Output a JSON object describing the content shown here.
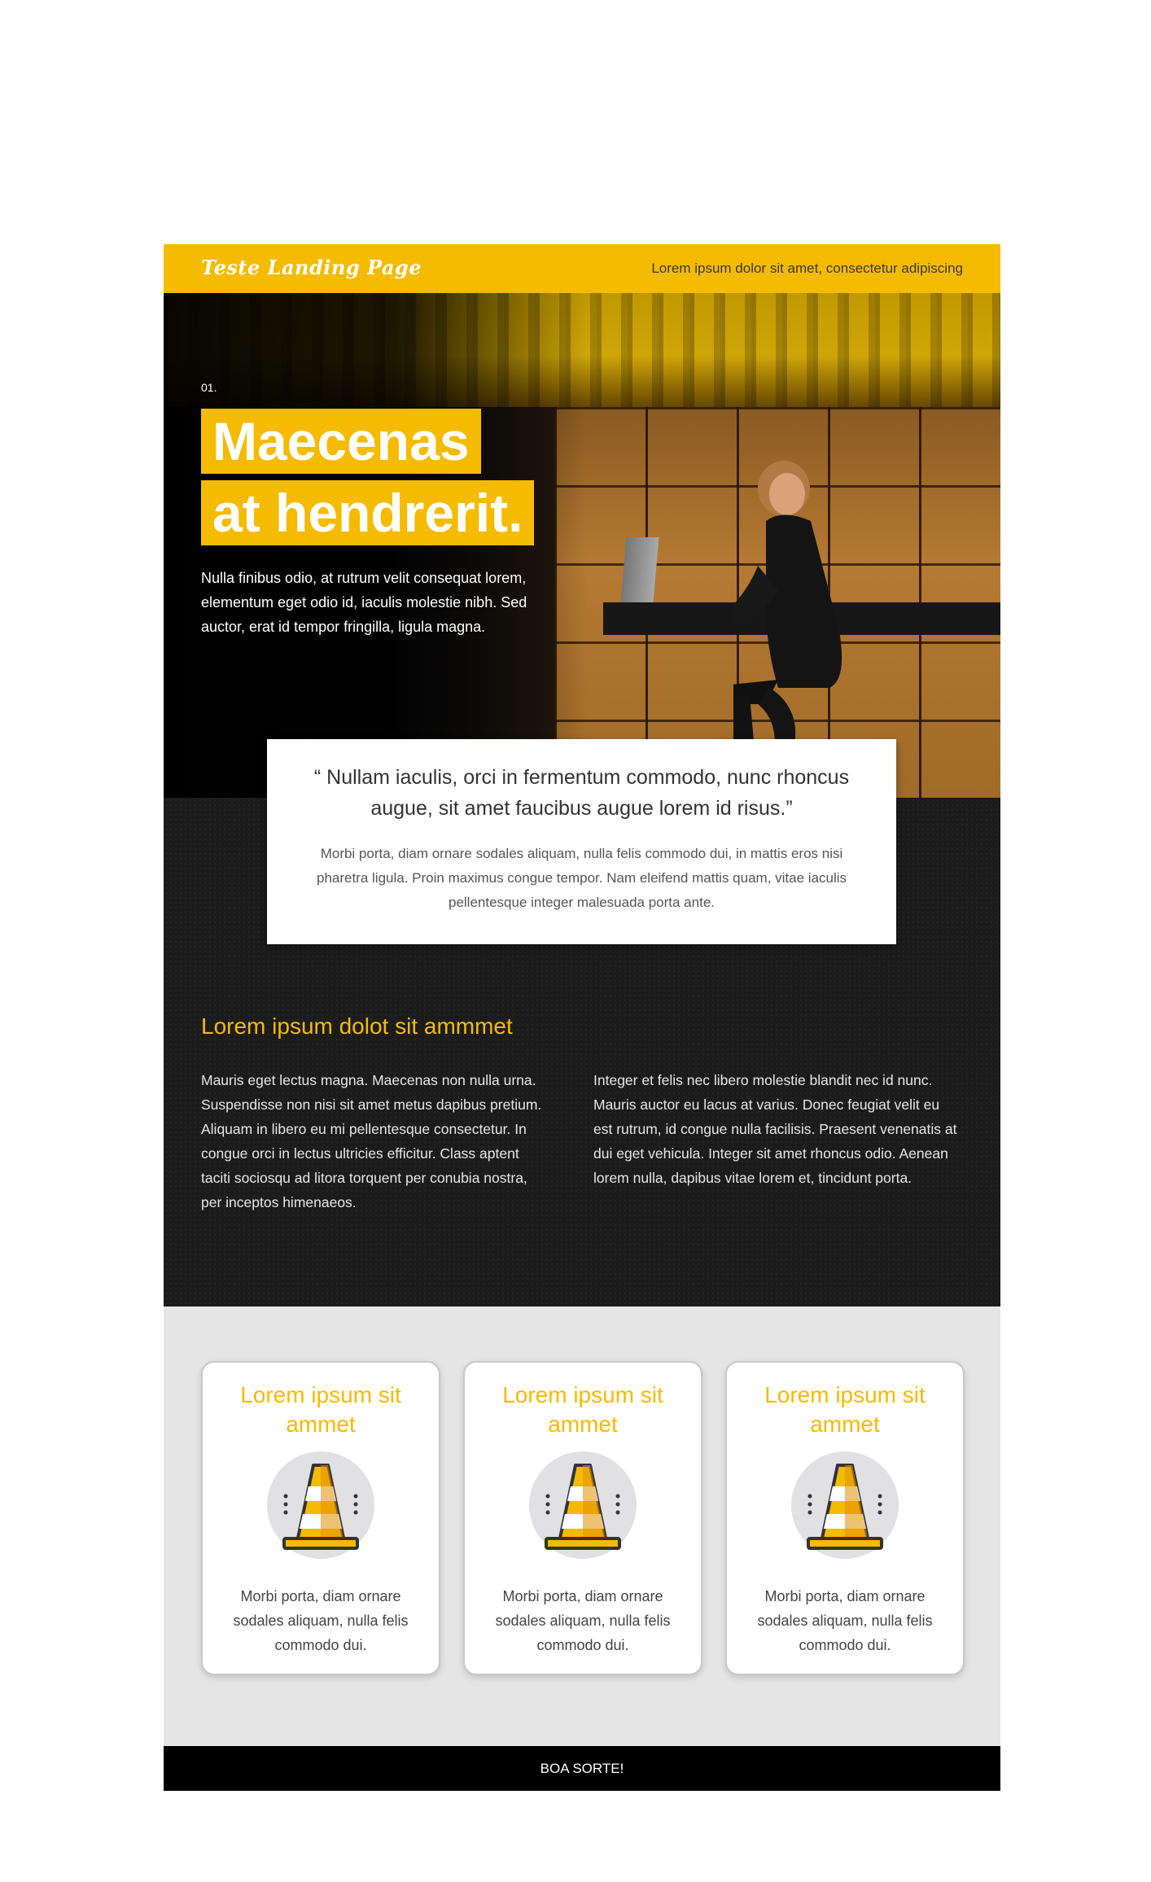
{
  "header": {
    "brand": "Teste Landing Page",
    "tagline": "Lorem ipsum dolor sit amet, consectetur adipiscing"
  },
  "hero": {
    "step": "01.",
    "headline_line1": "Maecenas",
    "headline_line2": "at hendrerit.",
    "text": "Nulla finibus odio, at rutrum velit consequat lorem, elementum eget odio id, iaculis molestie nibh. Sed auctor, erat id tempor fringilla, ligula magna."
  },
  "quote": {
    "text": "“ Nullam iaculis, orci in fermentum commodo, nunc rhoncus augue, sit amet faucibus augue lorem id risus.”",
    "subtext": "Morbi porta, diam ornare sodales aliquam, nulla felis commodo dui, in mattis eros nisi pharetra ligula. Proin maximus congue tempor. Nam eleifend mattis quam, vitae iaculis pellentesque integer malesuada porta ante."
  },
  "section": {
    "title": "Lorem ipsum dolot sit ammmet",
    "col1": "Mauris eget lectus magna. Maecenas non nulla urna. Suspendisse non nisi sit amet metus dapibus pretium. Aliquam in libero eu mi pellentesque consectetur. In congue orci in lectus ultricies efficitur. Class aptent taciti sociosqu ad litora torquent per conubia nostra, per inceptos himenaeos.",
    "col2": "Integer et felis nec libero molestie blandit nec id nunc. Mauris auctor eu lacus at varius. Donec feugiat velit eu est rutrum, id congue nulla facilisis. Praesent venenatis at dui eget vehicula. Integer sit amet rhoncus odio. Aenean lorem nulla, dapibus vitae lorem et, tincidunt porta."
  },
  "cards": [
    {
      "title": "Lorem ipsum sit ammet",
      "icon": "traffic-cone-icon",
      "text": "Morbi porta, diam ornare sodales aliquam, nulla felis commodo dui."
    },
    {
      "title": "Lorem ipsum sit ammet",
      "icon": "traffic-cone-icon",
      "text": "Morbi porta, diam ornare sodales aliquam, nulla felis commodo dui."
    },
    {
      "title": "Lorem ipsum sit ammet",
      "icon": "traffic-cone-icon",
      "text": "Morbi porta, diam ornare sodales aliquam, nulla felis commodo dui."
    }
  ],
  "footer": {
    "text": "BOA SORTE!"
  },
  "colors": {
    "accent": "#f5bb00",
    "dark": "#1b1b1b",
    "grey": "#e5e5e6"
  }
}
